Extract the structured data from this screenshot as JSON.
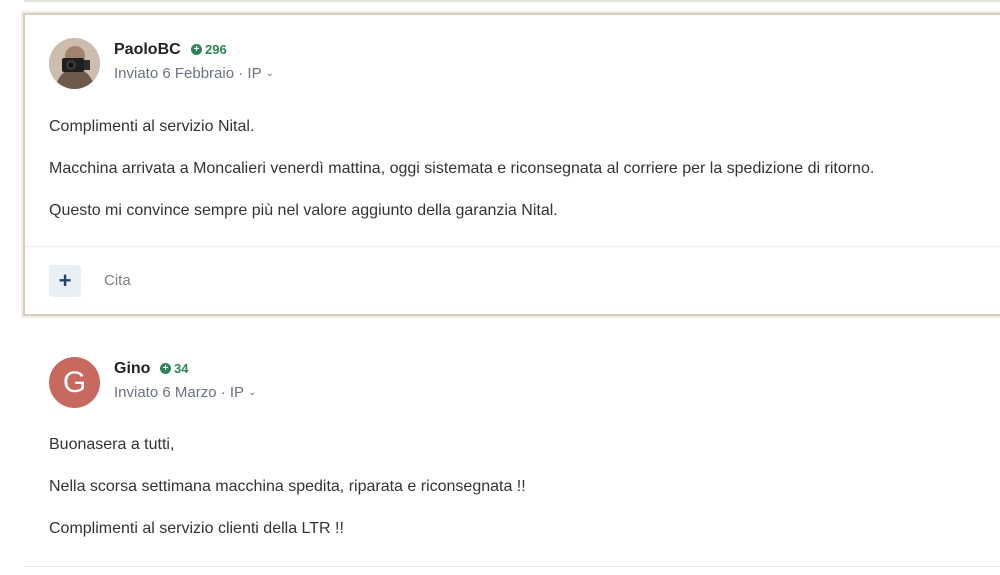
{
  "posts": [
    {
      "author": "PaoloBC",
      "reputation": "296",
      "meta": "Inviato 6 Febbraio · IP",
      "avatar_icon": "camera-photo-avatar",
      "paragraphs": [
        "Complimenti al servizio Nital.",
        "Macchina arrivata a Moncalieri venerdì mattina, oggi sistemata e riconsegnata al corriere per la spedizione di ritorno.",
        "Questo mi convince sempre più nel valore aggiunto della garanzia Nital."
      ],
      "actions": {
        "plus_icon": "plus-icon",
        "quote_label": "Cita"
      }
    },
    {
      "author": "Gino",
      "reputation": "34",
      "meta": "Inviato 6 Marzo · IP",
      "avatar_letter": "G",
      "avatar_color": "#c8695f",
      "paragraphs": [
        "Buonasera a tutti,",
        "Nella scorsa settimana macchina spedita, riparata e riconsegnata !!",
        "Complimenti al servizio clienti della LTR !!"
      ]
    }
  ],
  "colors": {
    "reputation_green": "#2e8552",
    "highlight_border": "#d8cebf",
    "action_button_bg": "#e8f0f6"
  }
}
